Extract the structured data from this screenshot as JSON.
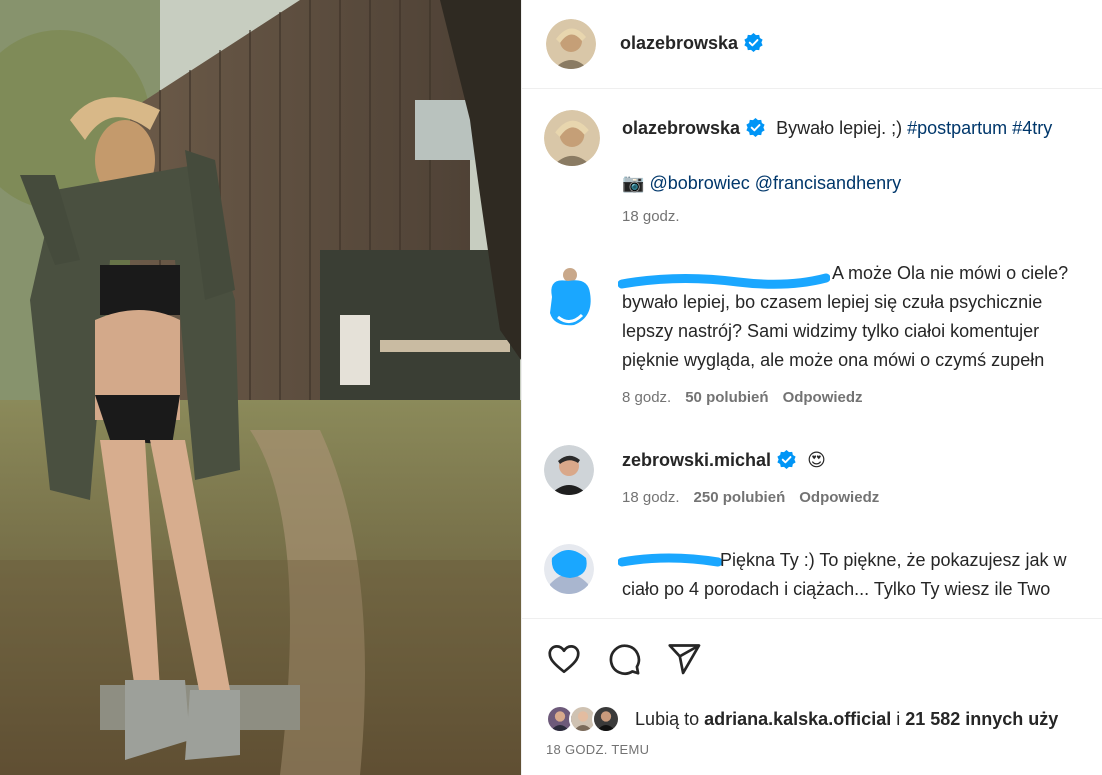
{
  "post": {
    "author": "olazebrowska",
    "caption_text": "Bywało lepiej. ;) ",
    "caption_tags": "#postpartum #4try",
    "caption_credits_icon": "📷",
    "caption_credits": "@bobrowiec @francisandhenry",
    "caption_time": "18 godz."
  },
  "comments": [
    {
      "lines": [
        "A może Ola nie mówi o ciele?",
        "bywało lepiej, bo czasem lepiej się czuła psychicznie",
        "lepszy nastrój? Sami widzimy tylko ciałoi komentujer",
        "pięknie wygląda, ale może ona mówi o czymś zupełn"
      ],
      "time": "8 godz.",
      "likes": "50 polubień",
      "reply": "Odpowiedz"
    },
    {
      "user": "zebrowski.michal",
      "text": "😍",
      "time": "18 godz.",
      "likes": "250 polubień",
      "reply": "Odpowiedz"
    },
    {
      "lines": [
        "Piękna Ty :) To piękne, że pokazujesz jak w",
        "ciało po 4 porodach i ciążach... Tylko Ty wiesz ile Two"
      ]
    }
  ],
  "likes": {
    "prefix": "Lubią to ",
    "user": "adriana.kalska.official",
    "middle": " i ",
    "count": "21 582 innych uży"
  },
  "timestamp": "18 GODZ. TEMU",
  "icons": {
    "verified": "verified-badge-icon",
    "like": "heart-icon",
    "comment": "comment-icon",
    "share": "paper-plane-icon"
  },
  "colors": {
    "verified": "#0095f6",
    "link": "#00376b",
    "meta": "#737373",
    "scribble": "#1aa7ff"
  }
}
